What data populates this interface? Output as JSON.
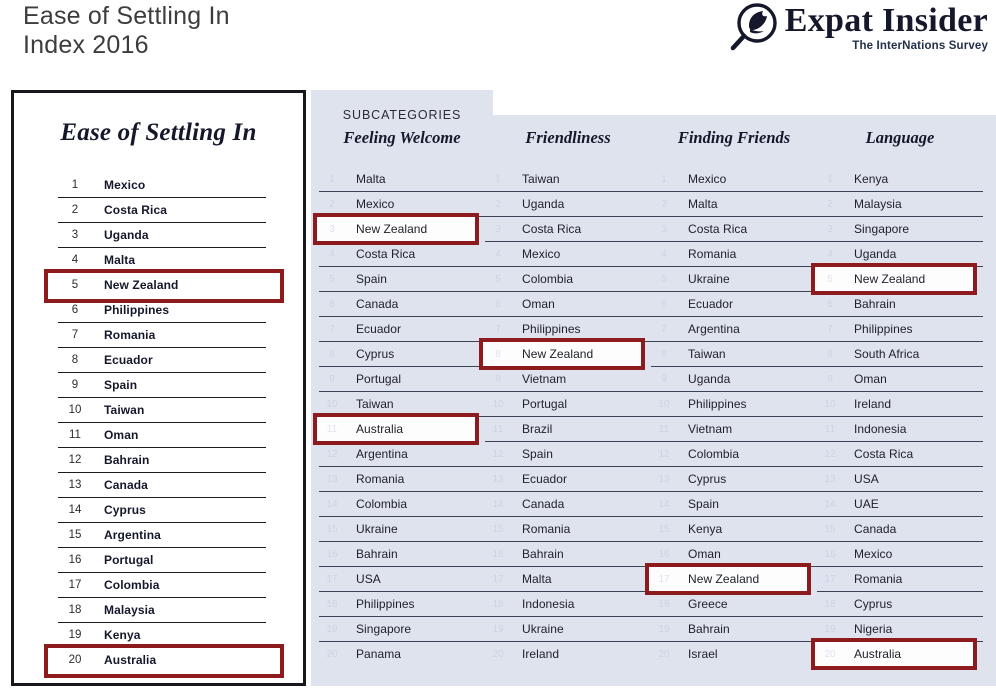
{
  "header": {
    "title": "Ease of Settling In\nIndex 2016",
    "brand_name": "Expat Insider",
    "brand_tagline": "The InterNations Survey",
    "brand_icon": "magnifier-bird-logo"
  },
  "colors": {
    "highlight_border": "#8d1a1c",
    "panel_background": "#dfe3ee",
    "card_border": "#17181c",
    "text_dark": "#15182b",
    "rank_muted": "#ccd3e2"
  },
  "main": {
    "heading": "Ease of Settling In",
    "highlighted": [
      "New Zealand",
      "Australia"
    ],
    "rows": [
      {
        "rank": "1",
        "country": "Mexico"
      },
      {
        "rank": "2",
        "country": "Costa Rica"
      },
      {
        "rank": "3",
        "country": "Uganda"
      },
      {
        "rank": "4",
        "country": "Malta"
      },
      {
        "rank": "5",
        "country": "New Zealand"
      },
      {
        "rank": "6",
        "country": "Philippines"
      },
      {
        "rank": "7",
        "country": "Romania"
      },
      {
        "rank": "8",
        "country": "Ecuador"
      },
      {
        "rank": "9",
        "country": "Spain"
      },
      {
        "rank": "10",
        "country": "Taiwan"
      },
      {
        "rank": "11",
        "country": "Oman"
      },
      {
        "rank": "12",
        "country": "Bahrain"
      },
      {
        "rank": "13",
        "country": "Canada"
      },
      {
        "rank": "14",
        "country": "Cyprus"
      },
      {
        "rank": "15",
        "country": "Argentina"
      },
      {
        "rank": "16",
        "country": "Portugal"
      },
      {
        "rank": "17",
        "country": "Colombia"
      },
      {
        "rank": "18",
        "country": "Malaysia"
      },
      {
        "rank": "19",
        "country": "Kenya"
      },
      {
        "rank": "20",
        "country": "Australia"
      }
    ]
  },
  "subcategories": {
    "label": "SUBCATEGORIES",
    "columns": [
      {
        "title": "Feeling Welcome",
        "highlighted": [
          "New Zealand",
          "Australia"
        ],
        "rows": [
          {
            "rank": "1",
            "country": "Malta"
          },
          {
            "rank": "2",
            "country": "Mexico"
          },
          {
            "rank": "3",
            "country": "New Zealand"
          },
          {
            "rank": "4",
            "country": "Costa Rica"
          },
          {
            "rank": "5",
            "country": "Spain"
          },
          {
            "rank": "6",
            "country": "Canada"
          },
          {
            "rank": "7",
            "country": "Ecuador"
          },
          {
            "rank": "8",
            "country": "Cyprus"
          },
          {
            "rank": "9",
            "country": "Portugal"
          },
          {
            "rank": "10",
            "country": "Taiwan"
          },
          {
            "rank": "11",
            "country": "Australia"
          },
          {
            "rank": "12",
            "country": "Argentina"
          },
          {
            "rank": "13",
            "country": "Romania"
          },
          {
            "rank": "14",
            "country": "Colombia"
          },
          {
            "rank": "15",
            "country": "Ukraine"
          },
          {
            "rank": "16",
            "country": "Bahrain"
          },
          {
            "rank": "17",
            "country": "USA"
          },
          {
            "rank": "18",
            "country": "Philippines"
          },
          {
            "rank": "19",
            "country": "Singapore"
          },
          {
            "rank": "20",
            "country": "Panama"
          }
        ]
      },
      {
        "title": "Friendliness",
        "highlighted": [
          "New Zealand"
        ],
        "rows": [
          {
            "rank": "1",
            "country": "Taiwan"
          },
          {
            "rank": "2",
            "country": "Uganda"
          },
          {
            "rank": "3",
            "country": "Costa Rica"
          },
          {
            "rank": "4",
            "country": "Mexico"
          },
          {
            "rank": "5",
            "country": "Colombia"
          },
          {
            "rank": "6",
            "country": "Oman"
          },
          {
            "rank": "7",
            "country": "Philippines"
          },
          {
            "rank": "8",
            "country": "New Zealand"
          },
          {
            "rank": "9",
            "country": "Vietnam"
          },
          {
            "rank": "10",
            "country": "Portugal"
          },
          {
            "rank": "11",
            "country": "Brazil"
          },
          {
            "rank": "12",
            "country": "Spain"
          },
          {
            "rank": "13",
            "country": "Ecuador"
          },
          {
            "rank": "14",
            "country": "Canada"
          },
          {
            "rank": "15",
            "country": "Romania"
          },
          {
            "rank": "16",
            "country": "Bahrain"
          },
          {
            "rank": "17",
            "country": "Malta"
          },
          {
            "rank": "18",
            "country": "Indonesia"
          },
          {
            "rank": "19",
            "country": "Ukraine"
          },
          {
            "rank": "20",
            "country": "Ireland"
          }
        ]
      },
      {
        "title": "Finding Friends",
        "highlighted": [
          "New Zealand"
        ],
        "rows": [
          {
            "rank": "1",
            "country": "Mexico"
          },
          {
            "rank": "2",
            "country": "Malta"
          },
          {
            "rank": "3",
            "country": "Costa Rica"
          },
          {
            "rank": "4",
            "country": "Romania"
          },
          {
            "rank": "5",
            "country": "Ukraine"
          },
          {
            "rank": "6",
            "country": "Ecuador"
          },
          {
            "rank": "7",
            "country": "Argentina"
          },
          {
            "rank": "8",
            "country": "Taiwan"
          },
          {
            "rank": "9",
            "country": "Uganda"
          },
          {
            "rank": "10",
            "country": "Philippines"
          },
          {
            "rank": "11",
            "country": "Vietnam"
          },
          {
            "rank": "12",
            "country": "Colombia"
          },
          {
            "rank": "13",
            "country": "Cyprus"
          },
          {
            "rank": "14",
            "country": "Spain"
          },
          {
            "rank": "15",
            "country": "Kenya"
          },
          {
            "rank": "16",
            "country": "Oman"
          },
          {
            "rank": "17",
            "country": "New Zealand"
          },
          {
            "rank": "18",
            "country": "Greece"
          },
          {
            "rank": "19",
            "country": "Bahrain"
          },
          {
            "rank": "20",
            "country": "Israel"
          }
        ]
      },
      {
        "title": "Language",
        "highlighted": [
          "New Zealand",
          "Australia"
        ],
        "rows": [
          {
            "rank": "1",
            "country": "Kenya"
          },
          {
            "rank": "2",
            "country": "Malaysia"
          },
          {
            "rank": "3",
            "country": "Singapore"
          },
          {
            "rank": "4",
            "country": "Uganda"
          },
          {
            "rank": "5",
            "country": "New Zealand"
          },
          {
            "rank": "6",
            "country": "Bahrain"
          },
          {
            "rank": "7",
            "country": "Philippines"
          },
          {
            "rank": "8",
            "country": "South Africa"
          },
          {
            "rank": "9",
            "country": "Oman"
          },
          {
            "rank": "10",
            "country": "Ireland"
          },
          {
            "rank": "11",
            "country": "Indonesia"
          },
          {
            "rank": "12",
            "country": "Costa Rica"
          },
          {
            "rank": "13",
            "country": "USA"
          },
          {
            "rank": "14",
            "country": "UAE"
          },
          {
            "rank": "15",
            "country": "Canada"
          },
          {
            "rank": "16",
            "country": "Mexico"
          },
          {
            "rank": "17",
            "country": "Romania"
          },
          {
            "rank": "18",
            "country": "Cyprus"
          },
          {
            "rank": "19",
            "country": "Nigeria"
          },
          {
            "rank": "20",
            "country": "Australia"
          }
        ]
      }
    ]
  }
}
